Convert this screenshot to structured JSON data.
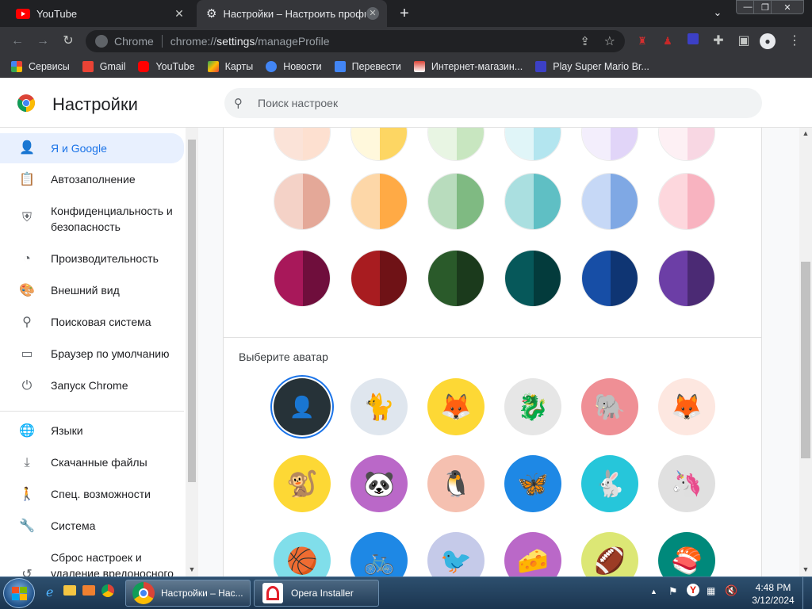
{
  "tabs": [
    {
      "title": "YouTube",
      "favicon": "youtube-icon"
    },
    {
      "title": "Настройки – Настроить профиль",
      "favicon": "gear-icon"
    }
  ],
  "omnibox": {
    "site": "Chrome",
    "url_prefix": "chrome://",
    "url_host": "settings",
    "url_path": "/manageProfile"
  },
  "bookmarks": [
    {
      "label": "Сервисы",
      "color": "#4285f4"
    },
    {
      "label": "Gmail",
      "color": "#ea4335"
    },
    {
      "label": "YouTube",
      "color": "#ff0000"
    },
    {
      "label": "Карты",
      "color": "#34a853"
    },
    {
      "label": "Новости",
      "color": "#4285f4"
    },
    {
      "label": "Перевести",
      "color": "#4285f4"
    },
    {
      "label": "Интернет-магазин...",
      "color": "#db4437"
    },
    {
      "label": "Play Super Mario Br...",
      "color": "#3c40c6"
    }
  ],
  "header": {
    "title": "Настройки",
    "search_placeholder": "Поиск настроек"
  },
  "sidebar": {
    "items": [
      {
        "label": "Я и Google",
        "icon": "person-icon"
      },
      {
        "label": "Автозаполнение",
        "icon": "clipboard-icon"
      },
      {
        "label": "Конфиденциальность и безопасность",
        "icon": "shield-icon"
      },
      {
        "label": "Производительность",
        "icon": "speedometer-icon"
      },
      {
        "label": "Внешний вид",
        "icon": "palette-icon"
      },
      {
        "label": "Поисковая система",
        "icon": "search-icon"
      },
      {
        "label": "Браузер по умолчанию",
        "icon": "browser-icon"
      },
      {
        "label": "Запуск Chrome",
        "icon": "power-icon"
      },
      {
        "label": "Языки",
        "icon": "globe-icon"
      },
      {
        "label": "Скачанные файлы",
        "icon": "download-icon"
      },
      {
        "label": "Спец. возможности",
        "icon": "accessibility-icon"
      },
      {
        "label": "Система",
        "icon": "wrench-icon"
      },
      {
        "label": "Сброс настроек и удаление вредоносного",
        "icon": "reset-icon"
      }
    ]
  },
  "colors": {
    "top_row": [
      [
        "#fbe3d8",
        "#fde0d0"
      ],
      [
        "#fff8dc",
        "#fdd663"
      ],
      [
        "#e8f5e3",
        "#c8e6c0"
      ],
      [
        "#e0f5f8",
        "#b3e5ef"
      ],
      [
        "#f3eefc",
        "#e1d5f8"
      ],
      [
        "#fdf0f4",
        "#f8d7e3"
      ]
    ],
    "mid_row": [
      [
        "#f4d2c7",
        "#e4a898"
      ],
      [
        "#fdd7a8",
        "#ffaa45"
      ],
      [
        "#b8dcbd",
        "#7fba82"
      ],
      [
        "#aadfe0",
        "#5fbfc4"
      ],
      [
        "#c6d8f6",
        "#7fa8e4"
      ],
      [
        "#fdd7dd",
        "#f8b3c0"
      ]
    ],
    "dark_row": [
      [
        "#a8185a",
        "#6f0e3c"
      ],
      [
        "#a81c20",
        "#6f1216"
      ],
      [
        "#2a5a2a",
        "#1b3a1c"
      ],
      [
        "#06585a",
        "#033b3c"
      ],
      [
        "#174ea6",
        "#0f3573"
      ],
      [
        "#6c3ea6",
        "#4b2a74"
      ]
    ]
  },
  "avatar_heading": "Выберите аватар",
  "avatars": [
    {
      "icon": "default-person-icon",
      "bg": "#263238",
      "selected": true
    },
    {
      "icon": "cat-icon",
      "bg": "#dfe6ee"
    },
    {
      "icon": "fox-icon",
      "bg": "#fdd835"
    },
    {
      "icon": "dragon-icon",
      "bg": "#e6e6e6"
    },
    {
      "icon": "elephant-icon",
      "bg": "#ef8f95"
    },
    {
      "icon": "fox-icon",
      "bg": "#fde7e0"
    },
    {
      "icon": "monkey-icon",
      "bg": "#fdd835"
    },
    {
      "icon": "panda-icon",
      "bg": "#ba68c8"
    },
    {
      "icon": "penguin-icon",
      "bg": "#f5c0b0"
    },
    {
      "icon": "butterfly-icon",
      "bg": "#1e88e5"
    },
    {
      "icon": "rabbit-icon",
      "bg": "#26c6da"
    },
    {
      "icon": "unicorn-icon",
      "bg": "#e0e0e0"
    },
    {
      "icon": "basketball-icon",
      "bg": "#80deea"
    },
    {
      "icon": "bicycle-icon",
      "bg": "#1e88e5"
    },
    {
      "icon": "bird-icon",
      "bg": "#c5cae9"
    },
    {
      "icon": "cheese-icon",
      "bg": "#ba68c8"
    },
    {
      "icon": "football-icon",
      "bg": "#dce775"
    },
    {
      "icon": "sushi-icon",
      "bg": "#00897b"
    }
  ],
  "taskbar": {
    "chrome_task": "Настройки – Нас...",
    "opera_task": "Opera Installer",
    "time": "4:48 PM",
    "date": "3/12/2024"
  }
}
